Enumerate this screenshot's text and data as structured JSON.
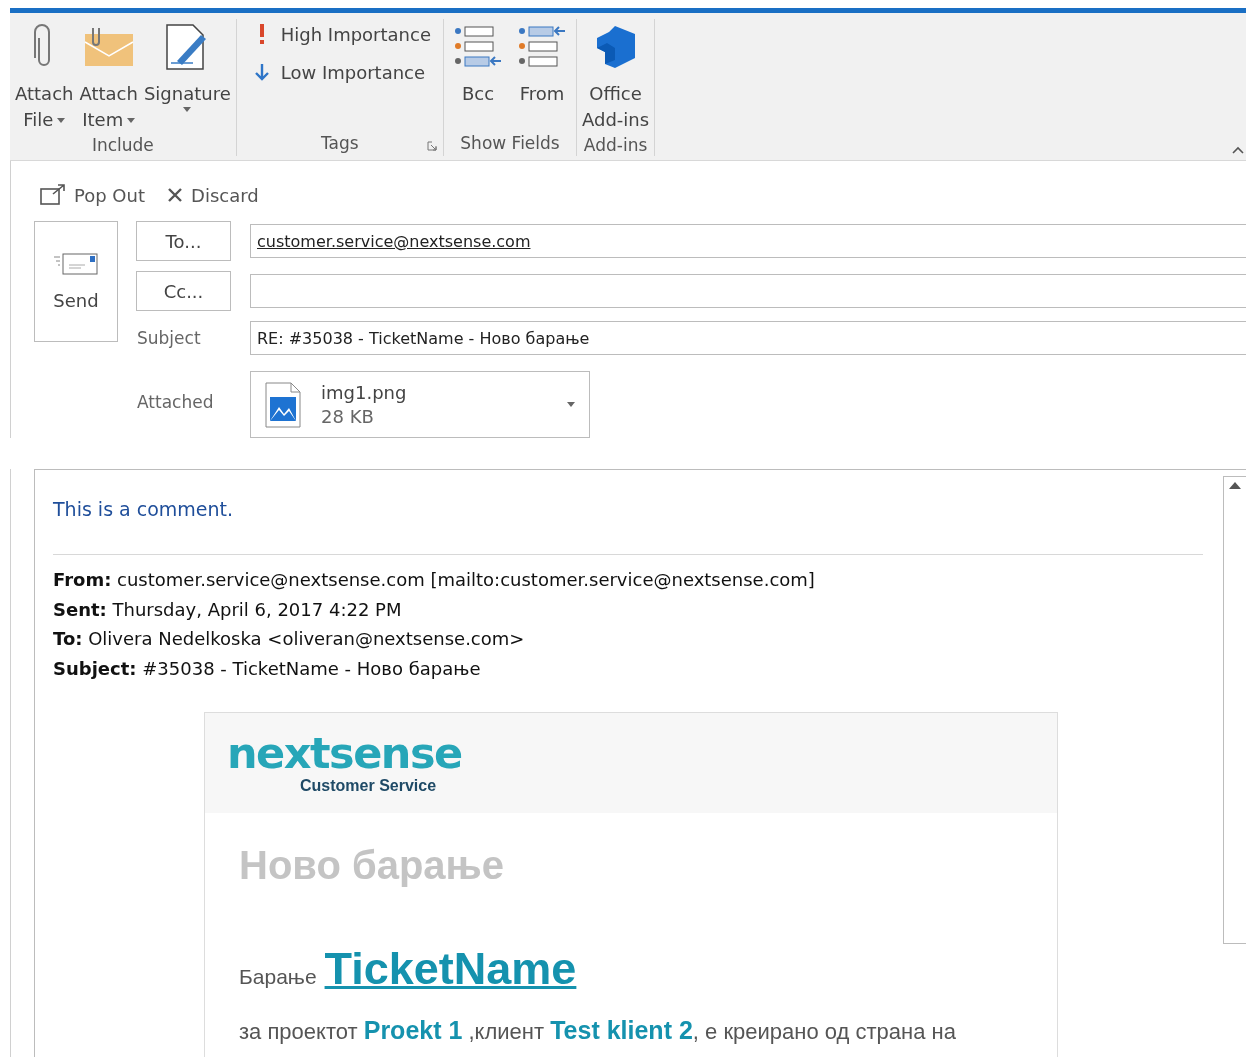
{
  "ribbon": {
    "groups": [
      {
        "label": "Include",
        "launcher": false,
        "buttons": [
          {
            "kind": "large",
            "lines": [
              "Attach",
              "File"
            ],
            "dropdown": true
          },
          {
            "kind": "large",
            "lines": [
              "Attach",
              "Item"
            ],
            "dropdown": true
          },
          {
            "kind": "large",
            "lines": [
              "Signature"
            ],
            "dropdown": true
          }
        ]
      },
      {
        "label": "Tags",
        "launcher": true,
        "buttons": [
          {
            "kind": "small",
            "lines": [
              "High Importance"
            ],
            "dropdown": false
          },
          {
            "kind": "small",
            "lines": [
              "Low Importance"
            ],
            "dropdown": false
          }
        ]
      },
      {
        "label": "Show Fields",
        "launcher": false,
        "buttons": [
          {
            "kind": "large",
            "lines": [
              "Bcc"
            ],
            "dropdown": false
          },
          {
            "kind": "large",
            "lines": [
              "From"
            ],
            "dropdown": false
          }
        ]
      },
      {
        "label": "Add-ins",
        "launcher": false,
        "buttons": [
          {
            "kind": "large",
            "lines": [
              "Office",
              "Add-ins"
            ],
            "dropdown": false
          }
        ]
      }
    ]
  },
  "compose_toolbar": [
    {
      "kind": "popout",
      "label": "Pop Out"
    },
    {
      "kind": "discard",
      "label": "Discard"
    }
  ],
  "send_button": "Send",
  "to": {
    "button": "To...",
    "value": "customer.service@nextsense.com"
  },
  "cc": {
    "button": "Cc..."
  },
  "subject": {
    "label": "Subject",
    "value": "RE: #35038 - TicketName - Ново барање"
  },
  "attached": {
    "label": "Attached",
    "name": "img1.png",
    "size": "28 KB"
  },
  "body": {
    "comment": "This is a comment.",
    "header": [
      {
        "label": "From:",
        "value": "customer.service@nextsense.com [mailto:customer.service@nextsense.com]"
      },
      {
        "label": "Sent:",
        "value": "Thursday, April 6, 2017 4:22 PM"
      },
      {
        "label": "To:",
        "value": "Olivera Nedelkoska <oliveran@nextsense.com>"
      },
      {
        "label": "Subject:",
        "value": "#35038 - TicketName - Ново барање"
      }
    ],
    "card": {
      "logo": "nextsense",
      "logo_tagline": "Customer Service",
      "heading": "Ново барање",
      "request_label": "Барање",
      "ticket_link": "TicketName",
      "line": [
        {
          "kind": "plain",
          "text": "за проектот "
        },
        {
          "kind": "link",
          "text": "Proekt 1"
        },
        {
          "kind": "plain",
          "text": " ,клиент "
        },
        {
          "kind": "link",
          "text": "Test klient 2"
        },
        {
          "kind": "plain",
          "text": ", е креирано од страна на"
        }
      ]
    }
  }
}
